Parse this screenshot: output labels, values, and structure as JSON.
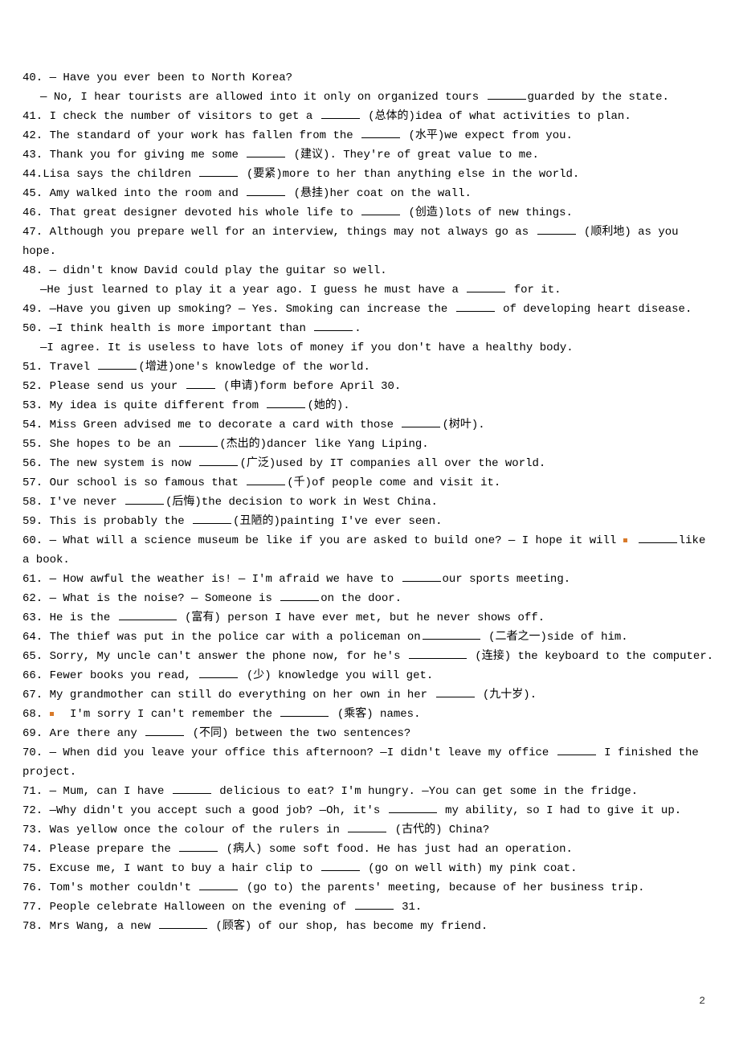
{
  "items": {
    "40": {
      "prefix": "40. — ",
      "textA": "Have you ever been to North Korea?",
      "lineB_prefix": "— ",
      "lineB_a": "No, I hear tourists are allowed into it only on organized tours ",
      "lineB_b": "guarded by the state."
    },
    "41": {
      "prefix": "41. ",
      "a": "I check the number of visitors to get a ",
      "b": " (总体的)idea of what activities to plan."
    },
    "42": {
      "prefix": "42. ",
      "a": "The standard of your work has fallen from the ",
      "b": "  (水平)we expect from you."
    },
    "43": {
      "prefix": "43. ",
      "a": "Thank you for giving me some ",
      "b": "  (建议). They're of great value to me."
    },
    "44": {
      "prefix": "44.",
      "a": "Lisa says the children ",
      "b": " (要紧)more to her than anything else in the world."
    },
    "45": {
      "prefix": "45. ",
      "a": "Amy walked into the room and ",
      "b": " (悬挂)her coat on the wall."
    },
    "46": {
      "prefix": "46. ",
      "a": "That great designer devoted his whole life to ",
      "b": " (创造)lots of new things."
    },
    "47": {
      "prefix": "47. ",
      "a": "Although you prepare well for an interview, things may not always go as ",
      "b": " (顺利地)  as you hope."
    },
    "48": {
      "prefix": "48. — ",
      "textA": "didn't know David could play the guitar so well.",
      "lineB_prefix": "—",
      "lineB_a": "He just learned to play it a year ago. I guess he must have a ",
      "lineB_b": " for it."
    },
    "49": {
      "prefix": "49. ",
      "a": "—Have you given up smoking? — Yes. Smoking can increase the ",
      "b": " of developing heart disease."
    },
    "50": {
      "prefix": "50. ",
      "a": "—I think health is more important than ",
      "b": ".",
      "lineB_prefix": "—",
      "lineB": "I agree. It is useless to have lots of money if you don't have a healthy body."
    },
    "51": {
      "prefix": "51. ",
      "a": "Travel ",
      "b": "(增进)one's knowledge of the world."
    },
    "52": {
      "prefix": "52. ",
      "a": "Please send us your ",
      "b": " (申请)form before April 30."
    },
    "53": {
      "prefix": "53. ",
      "a": "My idea is quite different from ",
      "b": "(她的)."
    },
    "54": {
      "prefix": "54. ",
      "a": "Miss Green advised me to decorate a card with those ",
      "b": "(树叶)."
    },
    "55": {
      "prefix": "55. ",
      "a": "She hopes to be an ",
      "b": "(杰出的)dancer like Yang Liping."
    },
    "56": {
      "prefix": "56. ",
      "a": "The new system is now ",
      "b": "(广泛)used by IT companies all over the world."
    },
    "57": {
      "prefix": "57. ",
      "a": "Our school is so famous that ",
      "b": "(千)of people come and visit it."
    },
    "58": {
      "prefix": "58. ",
      "a": "I've never ",
      "b": "(后悔)the decision to work in West China."
    },
    "59": {
      "prefix": "59. ",
      "a": "This is probably the ",
      "b": "(丑陋的)painting I've ever seen."
    },
    "60": {
      "prefix": "60. — ",
      "a": "What will a science museum be like if you are asked to build one?  — I hope it will ",
      "b": "like a book."
    },
    "61": {
      "prefix": "61. — ",
      "a": "How awful the weather is!  — I'm afraid we have to ",
      "b": "our sports meeting."
    },
    "62": {
      "prefix": "62. — ",
      "a": "What is the noise?   — Someone is ",
      "b": "on the door."
    },
    "63": {
      "prefix": "63. ",
      "a": "He is the ",
      "b": " (富有)  person I have ever met, but he never shows off."
    },
    "64": {
      "prefix": "64. ",
      "a": "The thief was put in the police car with a policeman on",
      "b": " (二者之一)side of him."
    },
    "65": {
      "prefix": "65. ",
      "a": "Sorry, My uncle can't answer the phone now, for he's ",
      "b": " (连接) the keyboard to the computer."
    },
    "66": {
      "prefix": "66. ",
      "a": "Fewer books you read, ",
      "b": " (少)  knowledge you will get."
    },
    "67": {
      "prefix": "67. ",
      "a": "My grandmother can still do everything on her own in her ",
      "b": " (九十岁)."
    },
    "68": {
      "prefix": "68. ",
      "a": "  I'm sorry I can't remember the ",
      "b": " (乘客) names."
    },
    "69": {
      "prefix": "69. ",
      "a": "Are there any ",
      "b": " (不同) between the two sentences?"
    },
    "70": {
      "prefix": "70. — ",
      "a": "When did you leave your office this afternoon?   —I didn't leave my office ",
      "b": " I finished the project."
    },
    "71": {
      "prefix": "71. — ",
      "a": "Mum, can I have ",
      "b": " delicious to eat? I'm hungry.   —You can get some in the fridge."
    },
    "72": {
      "prefix": "72. ",
      "a": "—Why didn't you accept such a good job?    —Oh, it's ",
      "b": " my ability, so I had to give it up."
    },
    "73": {
      "prefix": "73. ",
      "a": "Was yellow once the colour of the rulers in ",
      "b": " (古代的) China?"
    },
    "74": {
      "prefix": "74. ",
      "a": "Please prepare the ",
      "b": " (病人) some soft food. He has just had an operation."
    },
    "75": {
      "prefix": "75. ",
      "a": "Excuse me, I want to buy a hair clip to ",
      "b": " (go on well with) my pink coat."
    },
    "76": {
      "prefix": "76. ",
      "a": "Tom's mother couldn't ",
      "b": " (go to) the parents' meeting, because of her business trip."
    },
    "77": {
      "prefix": "77. ",
      "a": "People celebrate Halloween on the evening of ",
      "b": " 31."
    },
    "78": {
      "prefix": "78. ",
      "a": "Mrs Wang, a new ",
      "b": " (顾客) of our shop, has become my friend."
    }
  },
  "page_number": "2"
}
